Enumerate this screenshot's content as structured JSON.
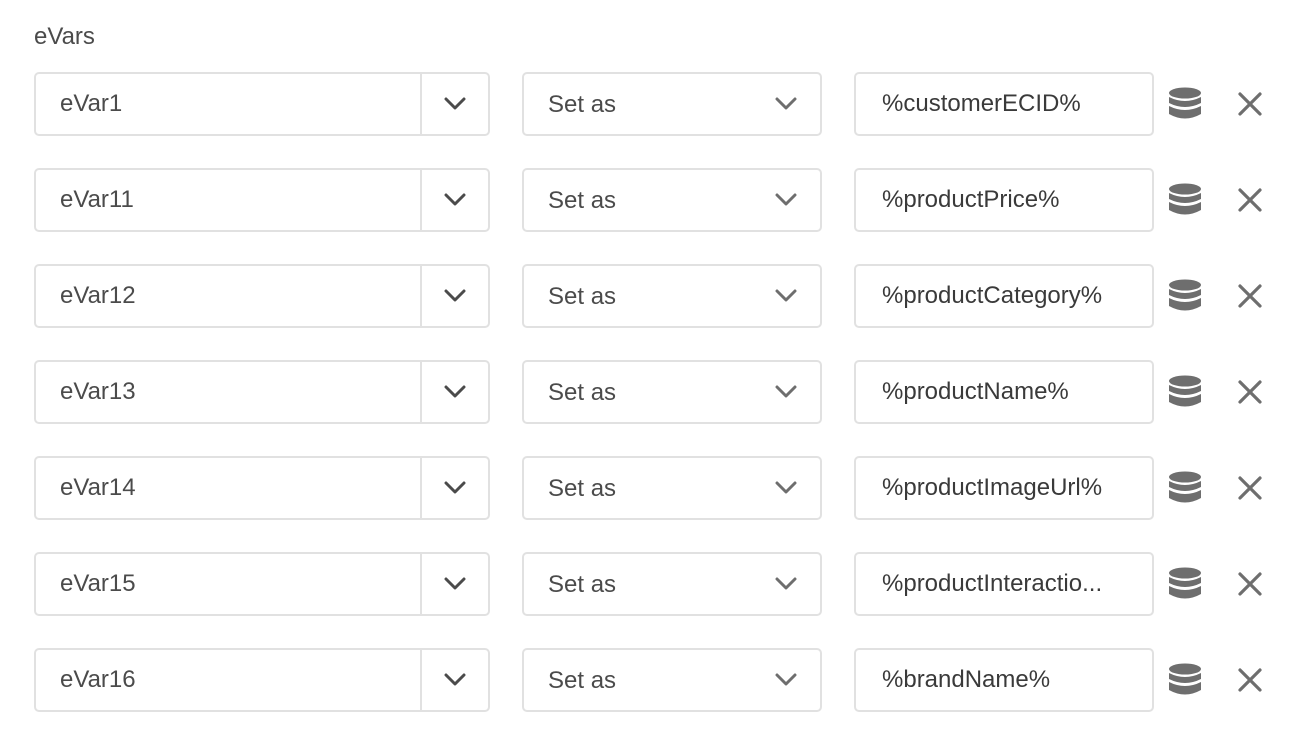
{
  "section": {
    "label": "eVars"
  },
  "picker_label": "Set as",
  "icons": {
    "dropdown": "chevron-down-icon",
    "data_element": "database-icon",
    "remove": "close-icon"
  },
  "colors": {
    "border": "#e1e1e1",
    "icon": "#6e6e6e",
    "text": "#4b4b4b"
  },
  "rows": [
    {
      "evar": "eVar1",
      "mode": "Set as",
      "value": "%customerECID%"
    },
    {
      "evar": "eVar11",
      "mode": "Set as",
      "value": "%productPrice%"
    },
    {
      "evar": "eVar12",
      "mode": "Set as",
      "value": "%productCategory%"
    },
    {
      "evar": "eVar13",
      "mode": "Set as",
      "value": "%productName%"
    },
    {
      "evar": "eVar14",
      "mode": "Set as",
      "value": "%productImageUrl%"
    },
    {
      "evar": "eVar15",
      "mode": "Set as",
      "value": "%productInteractio..."
    },
    {
      "evar": "eVar16",
      "mode": "Set as",
      "value": "%brandName%"
    }
  ]
}
